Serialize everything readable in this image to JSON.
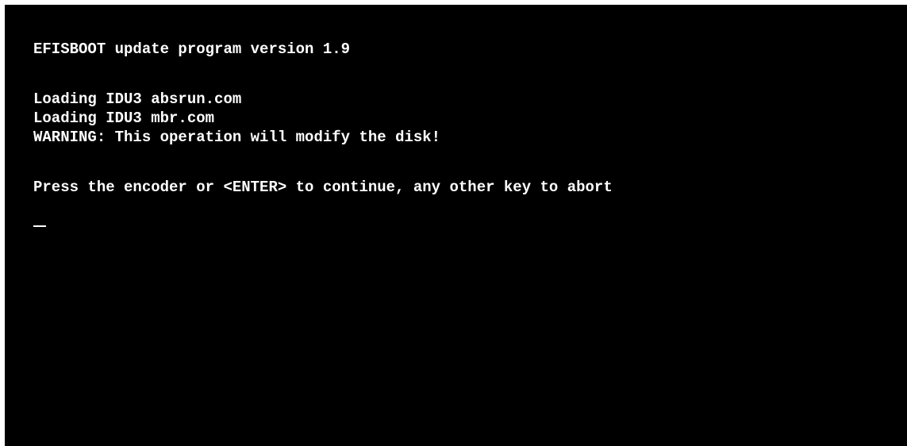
{
  "console": {
    "header": "EFISBOOT update program version 1.9",
    "loading_absrun": "Loading IDU3 absrun.com",
    "loading_mbr": "Loading IDU3 mbr.com",
    "warning": "WARNING: This operation will modify the disk!",
    "prompt": "Press the encoder or <ENTER> to continue, any other key to abort"
  },
  "colors": {
    "background": "#000000",
    "text": "#ffffff"
  }
}
